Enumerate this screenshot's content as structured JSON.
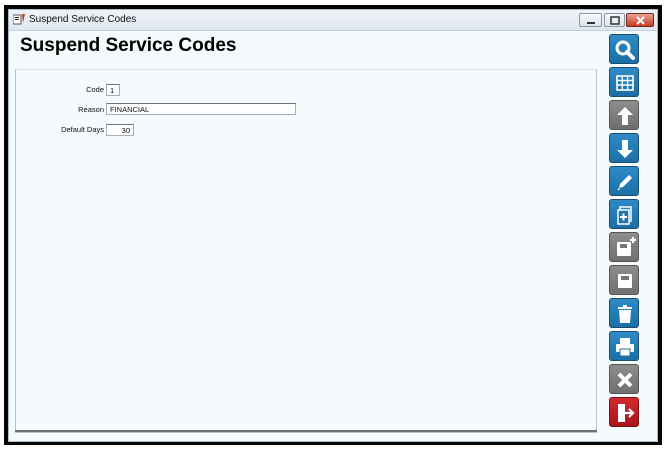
{
  "window": {
    "title": "Suspend Service Codes",
    "controls": [
      "minimize",
      "maximize",
      "close"
    ]
  },
  "page": {
    "title": "Suspend Service Codes"
  },
  "form": {
    "code": {
      "label": "Code",
      "value": "1"
    },
    "reason": {
      "label": "Reason",
      "value": "FINANCIAL"
    },
    "default_days": {
      "label": "Default Days",
      "value": "30"
    }
  },
  "toolbar": [
    {
      "icon": "search-icon",
      "style": "blue"
    },
    {
      "icon": "grid-icon",
      "style": "blue"
    },
    {
      "icon": "arrow-up-icon",
      "style": "gray"
    },
    {
      "icon": "arrow-down-icon",
      "style": "blue"
    },
    {
      "icon": "pencil-icon",
      "style": "blue"
    },
    {
      "icon": "copy-add-icon",
      "style": "blue"
    },
    {
      "icon": "save-new-icon",
      "style": "gray"
    },
    {
      "icon": "save-icon",
      "style": "gray"
    },
    {
      "icon": "trash-icon",
      "style": "blue"
    },
    {
      "icon": "print-icon",
      "style": "blue"
    },
    {
      "icon": "cancel-icon",
      "style": "gray"
    },
    {
      "icon": "exit-icon",
      "style": "red"
    }
  ],
  "colors": {
    "accent_blue": "#1b6fa6",
    "disabled_gray": "#7a7a7a",
    "exit_red": "#b5171d",
    "background": "#f5fbfd"
  }
}
